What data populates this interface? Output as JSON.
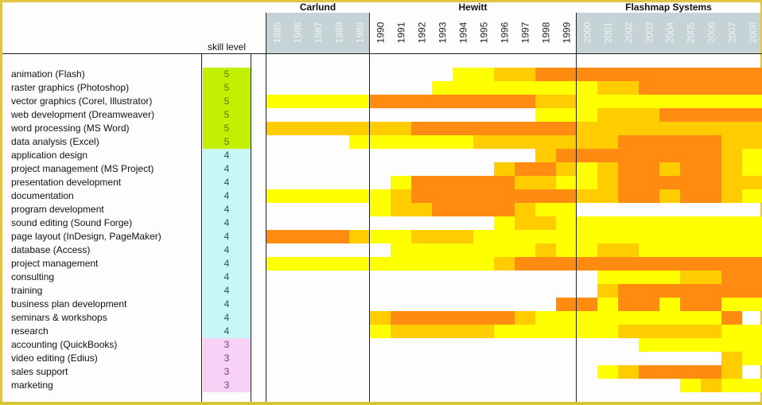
{
  "chart_data": {
    "type": "heatmap",
    "title": "",
    "skill_level_header": "skill level",
    "companies": [
      {
        "name": "Carlund",
        "years": [
          "1985",
          "1986",
          "1987",
          "1988",
          "1989"
        ],
        "dimmed": true
      },
      {
        "name": "Hewitt",
        "years": [
          "1990",
          "1991",
          "1992",
          "1993",
          "1994",
          "1995",
          "1996",
          "1997",
          "1998",
          "1999"
        ],
        "dimmed": false
      },
      {
        "name": "Flashmap Systems",
        "years": [
          "2000",
          "2001",
          "2002",
          "2003",
          "2004",
          "2005",
          "2006",
          "2007",
          "2008"
        ],
        "dimmed": true
      }
    ],
    "intensity_scale": {
      "0": "none",
      "1": "low",
      "2": "medium",
      "3": "high"
    },
    "colors": {
      "0": "transparent",
      "1": "#ffff00",
      "2": "#ffcc00",
      "3": "#ff8c10"
    },
    "level_colors": {
      "5": {
        "bg": "#c3f000",
        "fg": "#5a7a00"
      },
      "4": {
        "bg": "#c8f7f7",
        "fg": "#1f5560"
      },
      "3": {
        "bg": "#f8d2f6",
        "fg": "#7a3a7a"
      }
    },
    "rows": [
      {
        "skill": "animation (Flash)",
        "level": 5,
        "values": [
          0,
          0,
          0,
          0,
          0,
          0,
          0,
          0,
          0,
          1,
          1,
          2,
          2,
          3,
          3,
          3,
          3,
          3,
          3,
          3,
          3,
          3,
          3,
          3
        ]
      },
      {
        "skill": "raster graphics (Photoshop)",
        "level": 5,
        "values": [
          0,
          0,
          0,
          0,
          0,
          0,
          0,
          0,
          1,
          1,
          1,
          1,
          1,
          1,
          1,
          1,
          2,
          2,
          3,
          3,
          3,
          3,
          3,
          3
        ]
      },
      {
        "skill": "vector graphics (Corel, Illustrator)",
        "level": 5,
        "values": [
          1,
          1,
          1,
          1,
          1,
          3,
          3,
          3,
          3,
          3,
          3,
          3,
          3,
          2,
          2,
          1,
          1,
          1,
          1,
          1,
          1,
          1,
          1,
          1
        ]
      },
      {
        "skill": "web development (Dreamweaver)",
        "level": 5,
        "values": [
          0,
          0,
          0,
          0,
          0,
          0,
          0,
          0,
          0,
          0,
          0,
          0,
          0,
          1,
          1,
          1,
          2,
          2,
          2,
          3,
          3,
          3,
          3,
          3
        ]
      },
      {
        "skill": "word processing (MS Word)",
        "level": 5,
        "values": [
          2,
          2,
          2,
          2,
          2,
          2,
          2,
          3,
          3,
          3,
          3,
          3,
          3,
          3,
          3,
          2,
          2,
          2,
          2,
          2,
          2,
          2,
          2,
          2
        ]
      },
      {
        "skill": "data analysis (Excel)",
        "level": 5,
        "values": [
          0,
          0,
          0,
          0,
          1,
          1,
          1,
          1,
          1,
          1,
          2,
          2,
          2,
          2,
          2,
          2,
          2,
          3,
          3,
          3,
          3,
          3,
          2,
          2
        ]
      },
      {
        "skill": "application design",
        "level": 4,
        "values": [
          0,
          0,
          0,
          0,
          0,
          0,
          0,
          0,
          0,
          0,
          0,
          0,
          0,
          2,
          3,
          3,
          3,
          3,
          3,
          3,
          3,
          3,
          2,
          1
        ]
      },
      {
        "skill": "project management (MS Project)",
        "level": 4,
        "values": [
          0,
          0,
          0,
          0,
          0,
          0,
          0,
          0,
          0,
          0,
          0,
          2,
          3,
          3,
          2,
          1,
          2,
          3,
          3,
          2,
          3,
          3,
          2,
          1
        ]
      },
      {
        "skill": "presentation development",
        "level": 4,
        "values": [
          0,
          0,
          0,
          0,
          0,
          0,
          1,
          3,
          3,
          3,
          3,
          3,
          2,
          2,
          1,
          1,
          2,
          3,
          3,
          3,
          3,
          3,
          2,
          2
        ]
      },
      {
        "skill": "documentation",
        "level": 4,
        "values": [
          1,
          1,
          1,
          1,
          1,
          1,
          2,
          3,
          3,
          3,
          3,
          3,
          3,
          3,
          3,
          2,
          2,
          3,
          3,
          2,
          3,
          3,
          2,
          1
        ]
      },
      {
        "skill": "program development",
        "level": 4,
        "values": [
          0,
          0,
          0,
          0,
          0,
          1,
          2,
          2,
          3,
          3,
          3,
          3,
          2,
          1,
          1,
          0,
          0,
          0,
          0,
          0,
          0,
          0,
          0,
          0
        ]
      },
      {
        "skill": "sound editing (Sound Forge)",
        "level": 4,
        "values": [
          0,
          0,
          0,
          0,
          0,
          0,
          0,
          0,
          0,
          0,
          0,
          1,
          2,
          2,
          1,
          1,
          1,
          1,
          1,
          1,
          1,
          1,
          1,
          1
        ]
      },
      {
        "skill": "page layout (InDesign, PageMaker)",
        "level": 4,
        "values": [
          3,
          3,
          3,
          3,
          2,
          1,
          1,
          2,
          2,
          2,
          1,
          1,
          1,
          1,
          1,
          1,
          1,
          1,
          1,
          1,
          1,
          1,
          1,
          1
        ]
      },
      {
        "skill": "database (Access)",
        "level": 4,
        "values": [
          0,
          0,
          0,
          0,
          0,
          0,
          1,
          1,
          1,
          1,
          1,
          1,
          1,
          2,
          1,
          1,
          2,
          2,
          1,
          1,
          1,
          1,
          1,
          1
        ]
      },
      {
        "skill": "project management",
        "level": 4,
        "values": [
          1,
          1,
          1,
          1,
          1,
          1,
          1,
          1,
          1,
          1,
          1,
          2,
          3,
          3,
          3,
          3,
          3,
          3,
          3,
          3,
          3,
          3,
          3,
          3
        ]
      },
      {
        "skill": "consulting",
        "level": 4,
        "values": [
          0,
          0,
          0,
          0,
          0,
          0,
          0,
          0,
          0,
          0,
          0,
          0,
          0,
          0,
          0,
          0,
          1,
          1,
          1,
          1,
          2,
          2,
          3,
          3
        ]
      },
      {
        "skill": "training",
        "level": 4,
        "values": [
          0,
          0,
          0,
          0,
          0,
          0,
          0,
          0,
          0,
          0,
          0,
          0,
          0,
          0,
          0,
          0,
          2,
          3,
          3,
          3,
          3,
          3,
          3,
          3
        ]
      },
      {
        "skill": "business plan development",
        "level": 4,
        "values": [
          0,
          0,
          0,
          0,
          0,
          0,
          0,
          0,
          0,
          0,
          0,
          0,
          0,
          0,
          3,
          3,
          1,
          3,
          3,
          1,
          3,
          3,
          1,
          1
        ]
      },
      {
        "skill": "seminars & workshops",
        "level": 4,
        "values": [
          0,
          0,
          0,
          0,
          0,
          2,
          3,
          3,
          3,
          3,
          3,
          3,
          2,
          1,
          1,
          1,
          1,
          1,
          1,
          1,
          1,
          1,
          3,
          0
        ]
      },
      {
        "skill": "research",
        "level": 4,
        "values": [
          0,
          0,
          0,
          0,
          0,
          1,
          2,
          2,
          2,
          2,
          2,
          1,
          1,
          1,
          1,
          1,
          1,
          2,
          2,
          2,
          2,
          2,
          1,
          1
        ]
      },
      {
        "skill": "accounting (QuickBooks)",
        "level": 3,
        "values": [
          0,
          0,
          0,
          0,
          0,
          0,
          0,
          0,
          0,
          0,
          0,
          0,
          0,
          0,
          0,
          0,
          0,
          0,
          1,
          1,
          1,
          1,
          1,
          1
        ]
      },
      {
        "skill": "video editing (Edius)",
        "level": 3,
        "values": [
          0,
          0,
          0,
          0,
          0,
          0,
          0,
          0,
          0,
          0,
          0,
          0,
          0,
          0,
          0,
          0,
          0,
          0,
          0,
          0,
          0,
          0,
          2,
          1
        ]
      },
      {
        "skill": "sales support",
        "level": 3,
        "values": [
          0,
          0,
          0,
          0,
          0,
          0,
          0,
          0,
          0,
          0,
          0,
          0,
          0,
          0,
          0,
          0,
          1,
          2,
          3,
          3,
          3,
          3,
          2,
          0
        ]
      },
      {
        "skill": "marketing",
        "level": 3,
        "values": [
          0,
          0,
          0,
          0,
          0,
          0,
          0,
          0,
          0,
          0,
          0,
          0,
          0,
          0,
          0,
          0,
          0,
          0,
          0,
          0,
          1,
          2,
          1,
          1
        ]
      }
    ]
  }
}
